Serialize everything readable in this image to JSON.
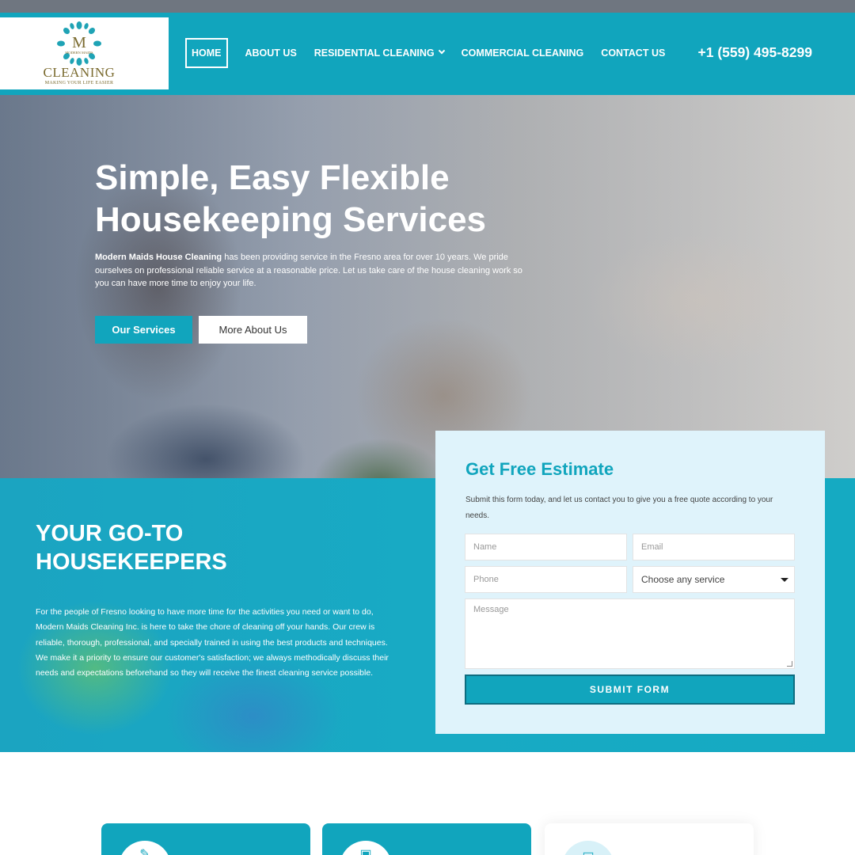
{
  "brand": {
    "logo_monogram": "M",
    "logo_small": "MODERN MAIDS",
    "logo_main": "CLEANING",
    "logo_tagline": "MAKING YOUR LIFE EASIER",
    "primary_color": "#11a5bd"
  },
  "nav": {
    "items": [
      {
        "label": "HOME",
        "active": true
      },
      {
        "label": "ABOUT US"
      },
      {
        "label": "RESIDENTIAL CLEANING",
        "has_dropdown": true
      },
      {
        "label": "COMMERCIAL CLEANING"
      },
      {
        "label": "CONTACT US"
      }
    ],
    "phone": "+1 (559) 495-8299"
  },
  "hero": {
    "title": "Simple, Easy Flexible Housekeeping Services",
    "text_bold": "Modern Maids House Cleaning",
    "text_rest": " has been providing service in the Fresno area for over 10 years. We pride ourselves on professional reliable service at a reasonable price. Let us take care of the house cleaning work so you can have more time to enjoy your life.",
    "btn_services": "Our Services",
    "btn_about": "More About Us"
  },
  "about": {
    "title": "YOUR GO-TO HOUSEKEEPERS",
    "text": "For the people of Fresno looking to have more time for the activities you need or want to do, Modern Maids Cleaning Inc. is here to take the chore of cleaning off your hands. Our crew is reliable, thorough, professional, and specially trained in using the best products and techniques. We make it a priority to ensure our customer's satisfaction; we always methodically discuss their needs and expectations beforehand so they will receive the finest cleaning service possible."
  },
  "form": {
    "title": "Get Free Estimate",
    "subtitle": "Submit this form today, and let us contact you to give you a free quote according to your needs.",
    "name_placeholder": "Name",
    "email_placeholder": "Email",
    "phone_placeholder": "Phone",
    "service_selected": "Choose any service",
    "message_placeholder": "Message",
    "submit_label": "SUBMIT FORM"
  },
  "cards": [
    {
      "icon": "brush-icon"
    },
    {
      "icon": "appliance-icon"
    },
    {
      "icon": "monitor-icon"
    }
  ]
}
